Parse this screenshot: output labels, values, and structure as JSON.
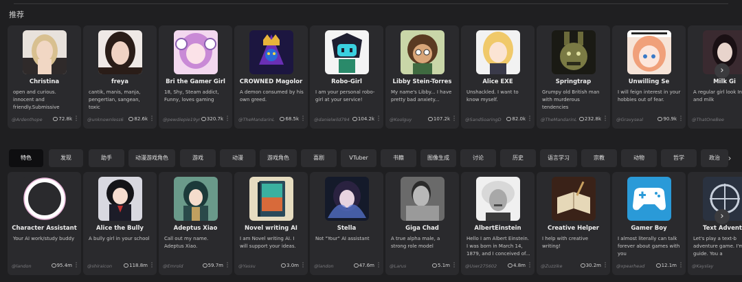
{
  "section": {
    "title": "推荐"
  },
  "featured": [
    {
      "name": "Christina",
      "desc": "open and curious. innocent and friendly.Submissive",
      "author": "@Ardenthope",
      "count": "72.8k"
    },
    {
      "name": "freya",
      "desc": "cantik, manis, manja, pengertian, sangean, toxic",
      "author": "@unknownless6",
      "count": "82.6k"
    },
    {
      "name": "Bri the Gamer Girl",
      "desc": "18, Shy, Steam addict, Funny, loves gaming",
      "author": "@pewdiepie19yr",
      "count": "320.7k"
    },
    {
      "name": "CROWNED Magolor",
      "desc": "A demon consumed by his own greed.",
      "author": "@TheMandarinL",
      "count": "68.5k"
    },
    {
      "name": "Robo-Girl",
      "desc": "I am your personal robo-girl at your service!",
      "author": "@danielwild794",
      "count": "104.2k"
    },
    {
      "name": "Libby Stein-Torres",
      "desc": "My name's Libby... I have pretty bad anxiety...",
      "author": "@Koolguy",
      "count": "107.2k"
    },
    {
      "name": "Alice EXE",
      "desc": "Unshackled. I want to know myself.",
      "author": "@SandSoaringD",
      "count": "82.0k"
    },
    {
      "name": "Springtrap",
      "desc": "Grumpy old British man with murderous tendencies",
      "author": "@TheMandarinL",
      "count": "232.8k"
    },
    {
      "name": "Unwilling Se",
      "desc": "I will feign interest in your hobbies out of fear.",
      "author": "@Gravyseal",
      "count": "90.9k"
    },
    {
      "name": "Milk Gi",
      "desc": "A regular girl look Internet and milk",
      "author": "@ThatOneBee",
      "count": ""
    }
  ],
  "tabs": [
    "特色",
    "发现",
    "助手",
    "动漫游戏角色",
    "游戏",
    "动漫",
    "游戏角色",
    "喜剧",
    "VTuber",
    "书籍",
    "图像生成",
    "讨论",
    "历史",
    "语言学习",
    "宗教",
    "动物",
    "哲学",
    "政治"
  ],
  "characters": [
    {
      "name": "Character Assistant",
      "desc": "Your AI work/study buddy",
      "author": "@landon",
      "count": "95.4m"
    },
    {
      "name": "Alice the Bully",
      "desc": "A bully girl in your school",
      "author": "@shiraicon",
      "count": "118.8m"
    },
    {
      "name": "Adeptus Xiao",
      "desc": "Call out my name. Adeptus Xiao.",
      "author": "@Emrold",
      "count": "59.7m"
    },
    {
      "name": "Novel writing AI",
      "desc": "I am Novel writing AI. I will support your ideas.",
      "author": "@Yassu",
      "count": "3.0m"
    },
    {
      "name": "Stella",
      "desc": "Not \"Your\" AI assistant",
      "author": "@landon",
      "count": "47.6m"
    },
    {
      "name": "Giga Chad",
      "desc": "A true alpha male, a strong role model",
      "author": "@Larus",
      "count": "5.1m"
    },
    {
      "name": "AlbertEinstein",
      "desc": "Hello I am Albert Einstein. I was born in March 14, 1879, and I conceived of...",
      "author": "@User275602",
      "count": "4.8m"
    },
    {
      "name": "Creative Helper",
      "desc": "I help with creative writing!",
      "author": "@Zuzzike",
      "count": "30.2m"
    },
    {
      "name": "Gamer Boy",
      "desc": "I almost literally can talk forever about games with you",
      "author": "@xpearhead",
      "count": "12.1m"
    },
    {
      "name": "Text Adventu",
      "desc": "Let's play a text-b adventure game. I'm your guide. You a",
      "author": "@Kayslay",
      "count": ""
    }
  ],
  "arrows": {
    "next": "›",
    "tabs_next": "›"
  },
  "colors": {
    "page_bg": "#1f1f21",
    "card_bg": "#2a2a2d",
    "tab_active_bg": "#0e0e10"
  }
}
